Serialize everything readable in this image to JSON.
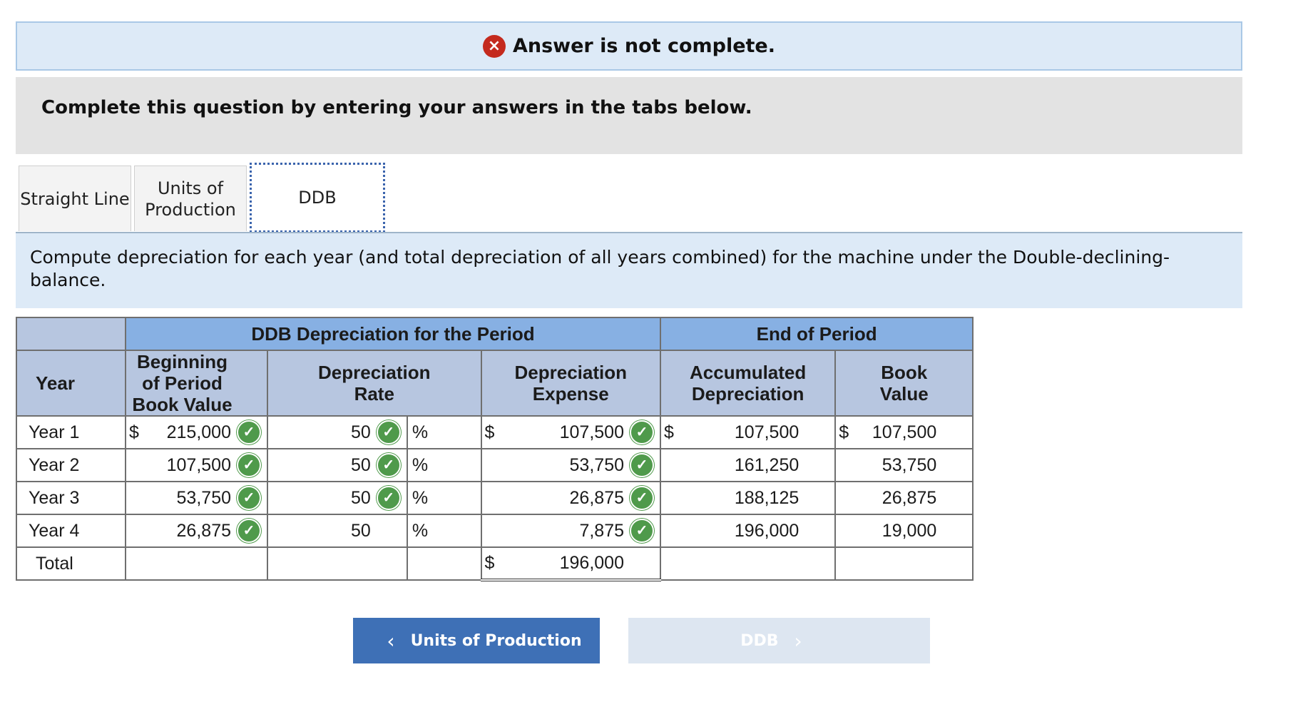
{
  "banner": {
    "text": "Answer is not complete.",
    "icon": "x-circle-icon"
  },
  "instruction": "Complete this question by entering your answers in the tabs below.",
  "tabs": [
    {
      "label": "Straight Line",
      "active": false
    },
    {
      "label": "Units of\nProduction",
      "active": false
    },
    {
      "label": "DDB",
      "active": true
    }
  ],
  "prompt": "Compute depreciation for each year (and total depreciation of all years combined) for the machine under the Double-declining-balance.",
  "table": {
    "group_headers": {
      "ddb": "DDB Depreciation for the Period",
      "end": "End of Period"
    },
    "col_headers": {
      "year": "Year",
      "beginning": "Beginning of Period Book Value",
      "rate": "Depreciation Rate",
      "expense": "Depreciation Expense",
      "accumulated": "Accumulated Depreciation",
      "book": "Book Value"
    },
    "rows": [
      {
        "year": "Year 1",
        "beginning": "215,000",
        "rate": "50",
        "pct": "%",
        "expense": "107,500",
        "accumulated": "107,500",
        "book": "107,500"
      },
      {
        "year": "Year 2",
        "beginning": "107,500",
        "rate": "50",
        "pct": "%",
        "expense": "53,750",
        "accumulated": "161,250",
        "book": "53,750"
      },
      {
        "year": "Year 3",
        "beginning": "53,750",
        "rate": "50",
        "pct": "%",
        "expense": "26,875",
        "accumulated": "188,125",
        "book": "26,875"
      },
      {
        "year": "Year 4",
        "beginning": "26,875",
        "rate": "50",
        "pct": "%",
        "expense": "7,875",
        "accumulated": "196,000",
        "book": "19,000"
      }
    ],
    "total": {
      "label": "Total",
      "expense": "196,000"
    },
    "currency": "$"
  },
  "nav": {
    "prev_label": "Units of Production",
    "next_label": "DDB"
  },
  "colors": {
    "check": "#4f9a4b",
    "error": "#c42a1e",
    "header": "#87b0e3",
    "subheader": "#b7c6e0",
    "button": "#3e70b6"
  }
}
